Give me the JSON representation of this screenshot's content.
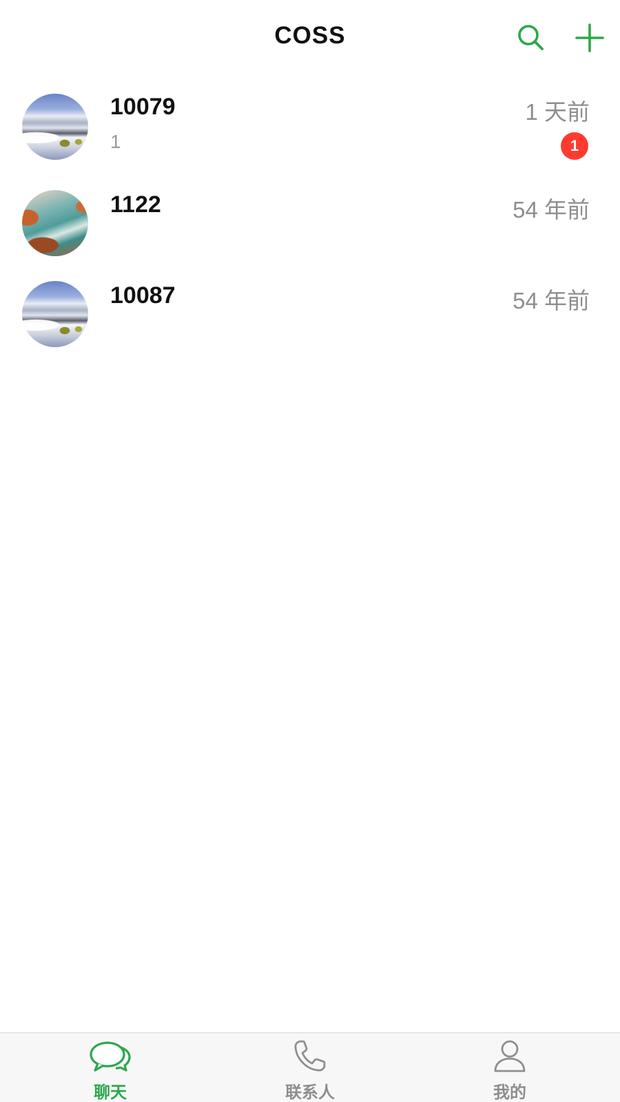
{
  "colors": {
    "accent": "#2ba84a",
    "badge": "#ff3b30",
    "inactive": "#8e8e8e",
    "text": "#111111",
    "secondary_text": "#8e8e8e"
  },
  "header": {
    "title": "COSS",
    "search_icon": "search-icon",
    "add_icon": "plus-icon"
  },
  "conversations": [
    {
      "name": "10079",
      "time": "1 天前",
      "preview": "1",
      "unread": "1",
      "avatar": "snowy-mountain-avatar"
    },
    {
      "name": "1122",
      "time": "54 年前",
      "preview": "",
      "unread": "",
      "avatar": "seashore-avatar"
    },
    {
      "name": "10087",
      "time": "54 年前",
      "preview": "",
      "unread": "",
      "avatar": "snowy-mountain-avatar"
    }
  ],
  "tabbar": {
    "tabs": [
      {
        "label": "聊天",
        "icon": "chat-bubbles-icon",
        "active": true
      },
      {
        "label": "联系人",
        "icon": "phone-icon",
        "active": false
      },
      {
        "label": "我的",
        "icon": "person-icon",
        "active": false
      }
    ]
  }
}
